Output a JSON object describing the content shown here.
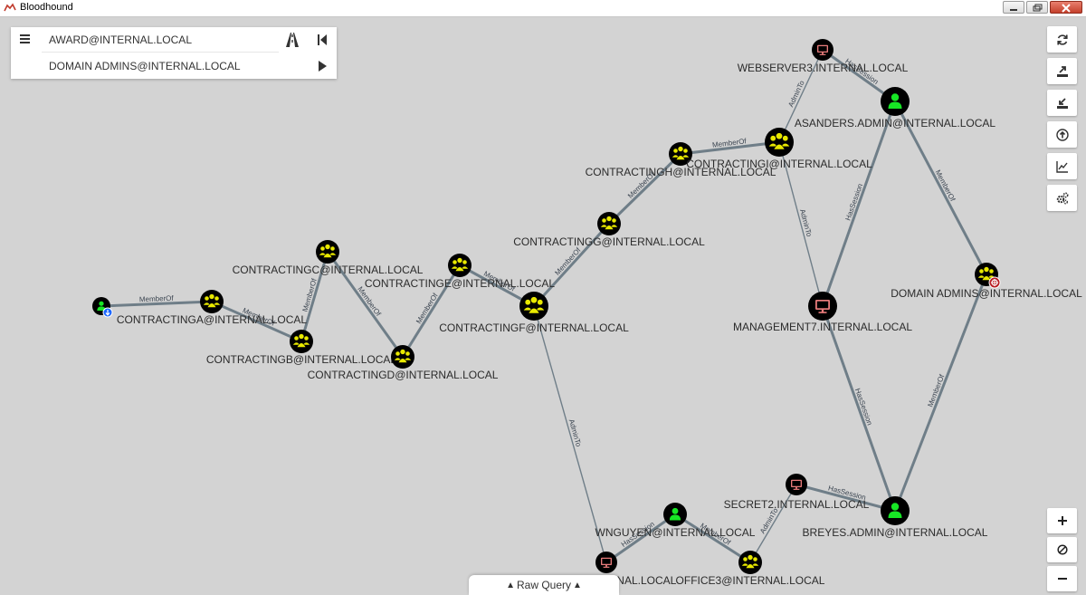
{
  "window": {
    "title": "Bloodhound"
  },
  "search": {
    "start_value": "AWARD@INTERNAL.LOCAL",
    "target_value": "DOMAIN ADMINS@INTERNAL.LOCAL"
  },
  "toolbar": {
    "items": [
      {
        "name": "refresh",
        "icon": "refresh-icon"
      },
      {
        "name": "export",
        "icon": "export-icon"
      },
      {
        "name": "import",
        "icon": "import-icon"
      },
      {
        "name": "upload",
        "icon": "upload-icon"
      },
      {
        "name": "stats",
        "icon": "chart-line-icon"
      },
      {
        "name": "settings",
        "icon": "gears-icon"
      }
    ]
  },
  "zoom": {
    "in_icon": "plus-icon",
    "reset_icon": "no-entry-icon",
    "out_icon": "minus-icon"
  },
  "raw_query": {
    "label": "Raw Query"
  },
  "colors": {
    "group": "#e8e800",
    "user": "#17e625",
    "computer": "#e77b7b",
    "node_bg": "#000000",
    "edge": "#6f7e88",
    "label": "#2b2b2b",
    "start_badge": "#1a66ff",
    "target_badge": "#b81c22"
  },
  "graph": {
    "nodes": [
      {
        "id": "award",
        "type": "user",
        "label": "",
        "badge": "start"
      },
      {
        "id": "ga",
        "type": "group",
        "label": "CONTRACTINGA@INTERNAL.LOCAL"
      },
      {
        "id": "gb",
        "type": "group",
        "label": "CONTRACTINGB@INTERNAL.LOCAL"
      },
      {
        "id": "gc",
        "type": "group",
        "label": "CONTRACTINGC@INTERNAL.LOCAL"
      },
      {
        "id": "gd",
        "type": "group",
        "label": "CONTRACTINGD@INTERNAL.LOCAL"
      },
      {
        "id": "ge",
        "type": "group",
        "label": "CONTRACTINGE@INTERNAL.LOCAL"
      },
      {
        "id": "gf",
        "type": "group",
        "label": "CONTRACTINGF@INTERNAL.LOCAL"
      },
      {
        "id": "gg",
        "type": "group",
        "label": "CONTRACTINGG@INTERNAL.LOCAL"
      },
      {
        "id": "gh",
        "type": "group",
        "label": "CONTRACTINGH@INTERNAL.LOCAL"
      },
      {
        "id": "gi",
        "type": "group",
        "label": "CONTRACTINGI@INTERNAL.LOCAL"
      },
      {
        "id": "ws3",
        "type": "computer",
        "label": "WEBSERVER3.INTERNAL.LOCAL"
      },
      {
        "id": "asanders",
        "type": "user",
        "label": "ASANDERS.ADMIN@INTERNAL.LOCAL"
      },
      {
        "id": "da",
        "type": "group",
        "label": "DOMAIN ADMINS@INTERNAL.LOCAL",
        "badge": "target"
      },
      {
        "id": "mgmt7",
        "type": "computer",
        "label": "MANAGEMENT7.INTERNAL.LOCAL"
      },
      {
        "id": "secret2",
        "type": "computer",
        "label": "SECRET2.INTERNAL.LOCAL"
      },
      {
        "id": "breyes",
        "type": "user",
        "label": "BREYES.ADMIN@INTERNAL.LOCAL"
      },
      {
        "id": "wnguyen",
        "type": "user",
        "label": "WNGUYEN@INTERNAL.LOCAL"
      },
      {
        "id": "office3",
        "type": "group",
        "label": "OFFICE3@INTERNAL.LOCAL"
      },
      {
        "id": "comp9",
        "type": "computer",
        "label": "RNAL.LOCAL"
      }
    ],
    "edges": [
      {
        "from": "award",
        "to": "ga",
        "label": "MemberOf"
      },
      {
        "from": "ga",
        "to": "gb",
        "label": "MemberOf"
      },
      {
        "from": "gb",
        "to": "gc",
        "label": "MemberOf"
      },
      {
        "from": "gc",
        "to": "gd",
        "label": "MemberOf"
      },
      {
        "from": "gd",
        "to": "ge",
        "label": "MemberOf"
      },
      {
        "from": "ge",
        "to": "gf",
        "label": "MemberOf"
      },
      {
        "from": "gf",
        "to": "gg",
        "label": "MemberOf"
      },
      {
        "from": "gg",
        "to": "gh",
        "label": "MemberOf"
      },
      {
        "from": "gh",
        "to": "gi",
        "label": "MemberOf"
      },
      {
        "from": "gi",
        "to": "ws3",
        "label": "AdminTo"
      },
      {
        "from": "ws3",
        "to": "asanders",
        "label": "HasSession"
      },
      {
        "from": "asanders",
        "to": "da",
        "label": "MemberOf"
      },
      {
        "from": "gi",
        "to": "mgmt7",
        "label": "AdminTo"
      },
      {
        "from": "mgmt7",
        "to": "asanders",
        "label": "HasSession"
      },
      {
        "from": "mgmt7",
        "to": "breyes",
        "label": "HasSession"
      },
      {
        "from": "breyes",
        "to": "da",
        "label": "MemberOf"
      },
      {
        "from": "secret2",
        "to": "breyes",
        "label": "HasSession"
      },
      {
        "from": "office3",
        "to": "secret2",
        "label": "AdminTo"
      },
      {
        "from": "wnguyen",
        "to": "office3",
        "label": "MemberOf"
      },
      {
        "from": "comp9",
        "to": "wnguyen",
        "label": "HasSession"
      },
      {
        "from": "gf",
        "to": "comp9",
        "label": "AdminTo"
      }
    ]
  }
}
